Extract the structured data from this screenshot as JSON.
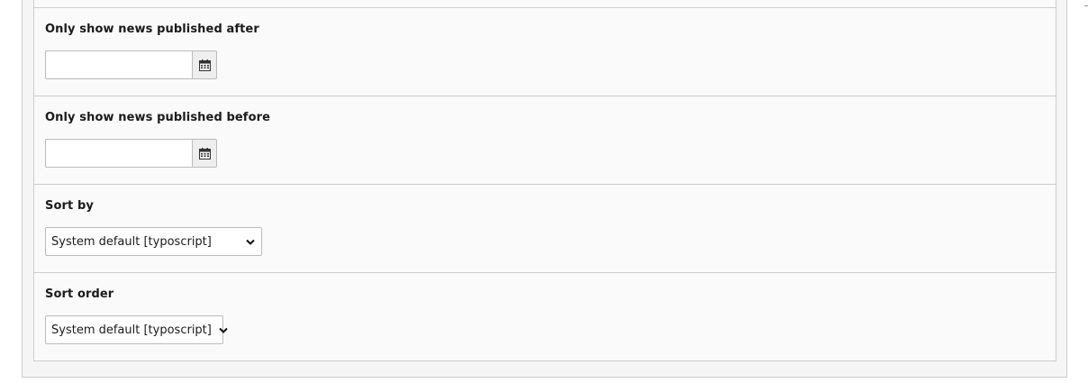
{
  "fields": {
    "published_after": {
      "label": "Only show news published after",
      "value": "",
      "picker_icon": "calendar-icon"
    },
    "published_before": {
      "label": "Only show news published before",
      "value": "",
      "picker_icon": "calendar-icon"
    },
    "sort_by": {
      "label": "Sort by",
      "selected": "System default [typoscript]",
      "icon": "chevron-down-icon"
    },
    "sort_order": {
      "label": "Sort order",
      "selected": "System default [typoscript]",
      "icon": "chevron-down-icon"
    }
  },
  "colors": {
    "panel_bg": "#f5f5f5",
    "inner_bg": "#fafafa",
    "border": "#cccccc",
    "button_bg": "#eeeeee"
  }
}
